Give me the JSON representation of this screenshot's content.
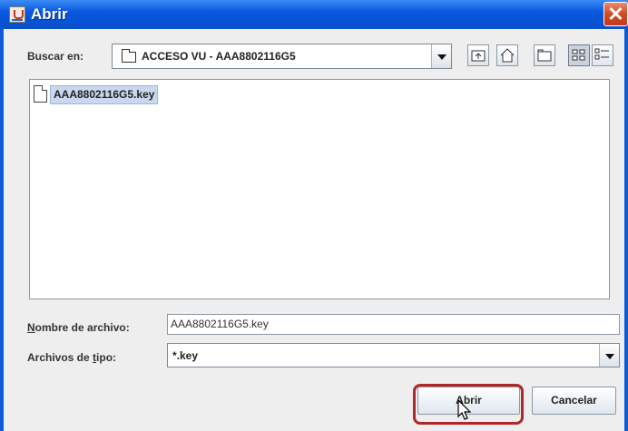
{
  "window": {
    "title": "Abrir",
    "close_symbol": "✕"
  },
  "look_in": {
    "label_pre": "Buscar en:",
    "value": "ACCESO VU - AAA8802116G5"
  },
  "toolbar": {
    "icons": [
      "up-folder-icon",
      "home-icon",
      "new-folder-icon",
      "list-view-icon",
      "details-view-icon"
    ]
  },
  "files": [
    {
      "name": "AAA8802116G5.key",
      "selected": true
    }
  ],
  "filename": {
    "label_u": "N",
    "label_rest": "ombre de archivo:",
    "value": "AAA8802116G5.key"
  },
  "filetype": {
    "label_pre": "Archivos de ",
    "label_u": "t",
    "label_post": "ipo:",
    "value": "*.key"
  },
  "buttons": {
    "open": "Abrir",
    "cancel": "Cancelar"
  },
  "colors": {
    "titlebar": "#0a58e0",
    "selection": "#c8d8ee",
    "highlight_border": "#b0262a"
  }
}
